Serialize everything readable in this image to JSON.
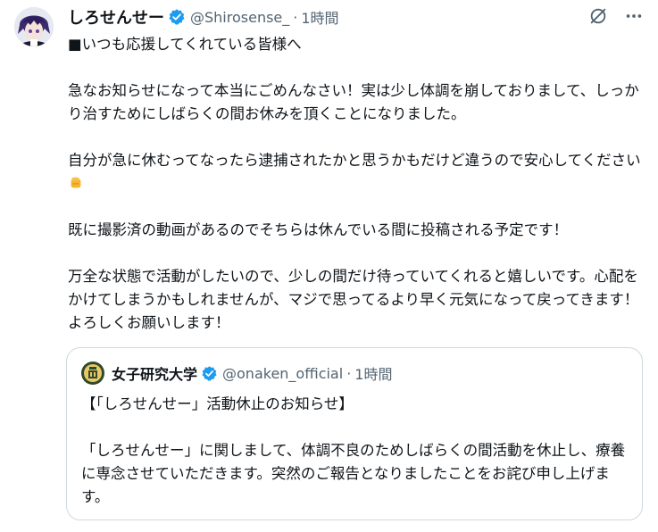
{
  "post": {
    "display_name": "しろせんせー",
    "handle": "@Shirosense_",
    "separator": "·",
    "time": "1時間",
    "paragraphs": [
      "■いつも応援してくれている皆様へ",
      "急なお知らせになって本当にごめんなさい！実は少し体調を崩しておりまして、しっかり治すためにしばらくの間お休みを頂くことになりました。",
      "自分が急に休むってなったら逮捕されたかと思うかもだけど違うので安心してください",
      "既に撮影済の動画があるのでそちらは休んでいる間に投稿される予定です！",
      "万全な状態で活動がしたいので、少しの間だけ待っていてくれると嬉しいです。心配をかけてしまうかもしれませんが、マジで思ってるより早く元気になって戻ってきます！よろしくお願いします！"
    ],
    "emoji": "fist-emoji"
  },
  "quote": {
    "display_name": "女子研究大学",
    "handle": "@onaken_official",
    "separator": "·",
    "time": "1時間",
    "paragraphs": [
      "【「しろせんせー」活動休止のお知らせ】",
      "「しろせんせー」に関しまして、体調不良のためしばらくの間活動を休止し、療養に専念させていただきます。突然のご報告となりましたことをお詫び申し上げます。"
    ]
  },
  "icons": {
    "verified": "verified-badge-icon",
    "grok": "grok-icon",
    "more": "more-options-icon"
  },
  "colors": {
    "verified_blue": "#1d9bf0",
    "secondary_text": "#536471",
    "border": "#cfd9de",
    "emoji_yellow": "#f5b52e"
  }
}
